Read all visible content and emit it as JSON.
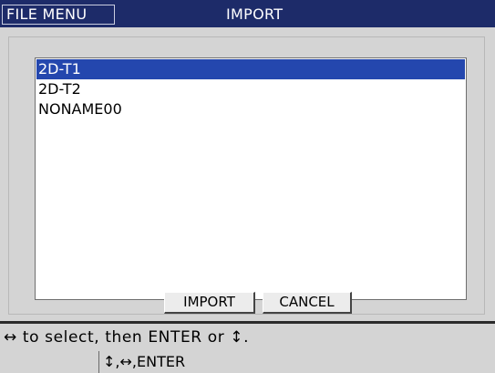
{
  "header": {
    "menu_label": "FILE MENU",
    "title": "IMPORT"
  },
  "file_list": {
    "items": [
      "2D-T1",
      "2D-T2",
      "NONAME00"
    ],
    "selected_index": 0
  },
  "buttons": {
    "import_label": "IMPORT",
    "cancel_label": "CANCEL"
  },
  "help": {
    "instruction": "↔ to select, then ENTER or ↕.",
    "keys": "↕,↔,ENTER"
  },
  "colors": {
    "title_bar": "#1d2b69",
    "selection": "#2447ae",
    "panel": "#d4d4d4"
  }
}
